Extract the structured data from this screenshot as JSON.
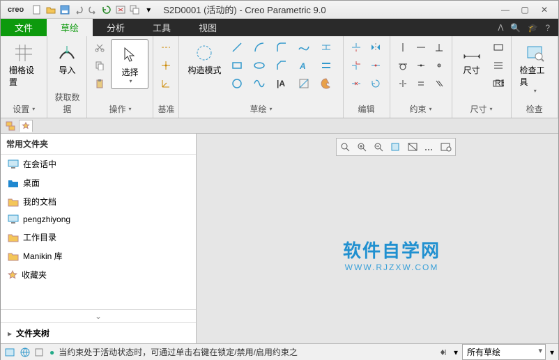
{
  "app": {
    "logo": "creo",
    "title": "S2D0001 (活动的) - Creo Parametric 9.0"
  },
  "tabs": {
    "file": "文件",
    "sketch": "草绘",
    "analysis": "分析",
    "tools": "工具",
    "view": "视图"
  },
  "ribbon": {
    "grid": {
      "label": "栅格设置",
      "group": "设置"
    },
    "import": {
      "label": "导入",
      "group": "获取数据"
    },
    "select": {
      "label": "选择",
      "group": "操作"
    },
    "datum": {
      "group": "基准"
    },
    "construct": {
      "label": "构造模式",
      "group": "草绘"
    },
    "edit": {
      "group": "编辑"
    },
    "constraint": {
      "group": "约束"
    },
    "dimension": {
      "label": "尺寸",
      "group": "尺寸"
    },
    "inspect": {
      "label": "检查工具",
      "group": "检查"
    }
  },
  "sidebar": {
    "header": "常用文件夹",
    "items": [
      {
        "icon": "monitor",
        "label": "在会话中"
      },
      {
        "icon": "folder-blue",
        "label": "桌面"
      },
      {
        "icon": "folder",
        "label": "我的文档"
      },
      {
        "icon": "monitor",
        "label": "pengzhiyong"
      },
      {
        "icon": "folder",
        "label": "工作目录"
      },
      {
        "icon": "folder",
        "label": "Manikin 库"
      },
      {
        "icon": "star",
        "label": "收藏夹"
      }
    ],
    "tree": "文件夹树"
  },
  "watermark": {
    "l1": "软件自学网",
    "l2": "WWW.RJZXW.COM"
  },
  "status": {
    "msg": "当约束处于活动状态时，可通过单击右键在锁定/禁用/启用约束之",
    "filter": "所有草绘"
  }
}
